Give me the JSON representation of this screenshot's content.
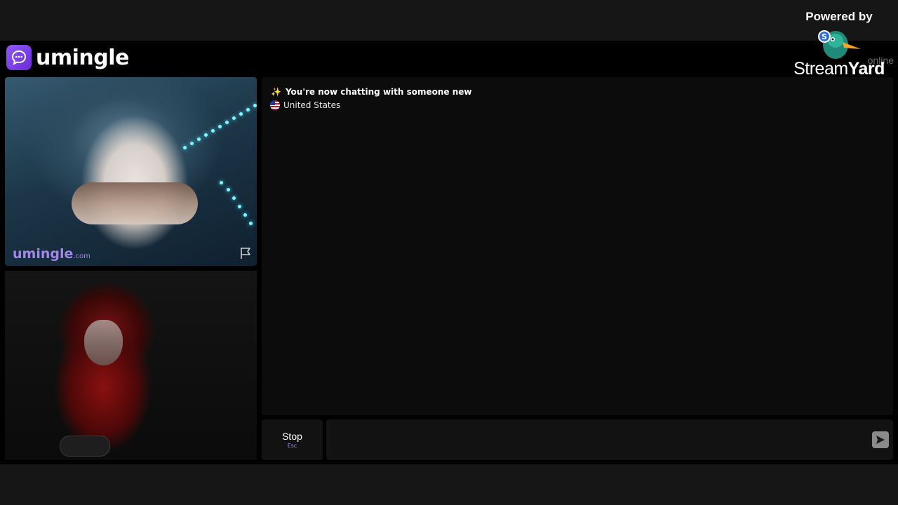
{
  "app": {
    "brand": "umingle",
    "online_text": "online"
  },
  "remote_video": {
    "watermark_main": "umingle",
    "watermark_suffix": ".com"
  },
  "chat": {
    "status_emoji": "✨",
    "status_text": "You're now chatting with someone new",
    "country": "United States"
  },
  "controls": {
    "stop_label": "Stop",
    "stop_hint": "Esc",
    "message_value": "",
    "message_placeholder": ""
  },
  "overlay": {
    "powered_by": "Powered by",
    "brand_stream": "Stream",
    "brand_yard": "Yard"
  },
  "colors": {
    "accent": "#8b5cf6",
    "app_background": "#000000",
    "frame_background": "#161616"
  }
}
